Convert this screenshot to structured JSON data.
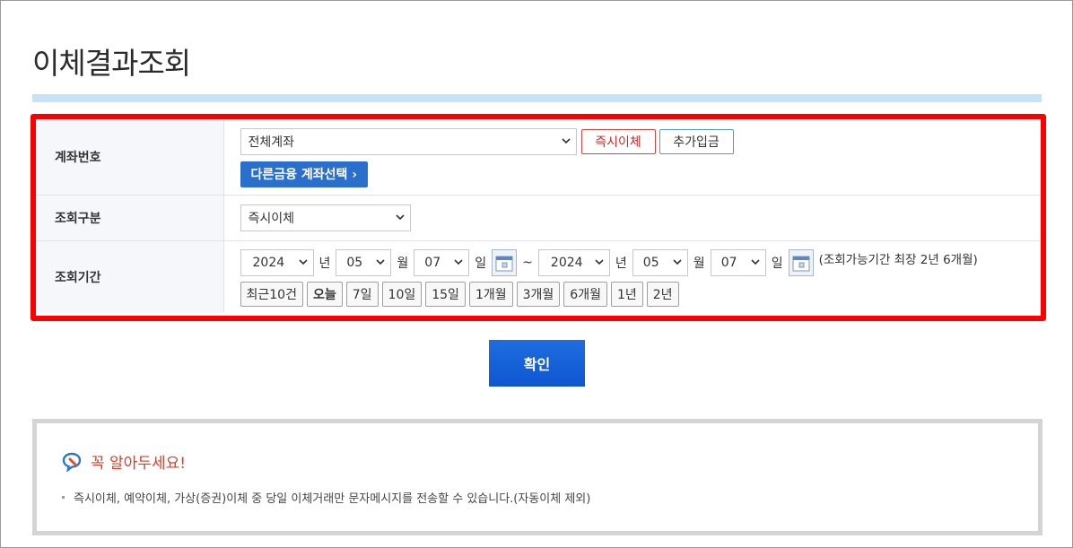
{
  "page": {
    "title": "이체결과조회"
  },
  "form": {
    "account": {
      "label": "계좌번호",
      "selected": "전체계좌",
      "btn_instant": "즉시이체",
      "btn_deposit": "추가입금",
      "btn_other": "다른금융 계좌선택 ›"
    },
    "category": {
      "label": "조회구분",
      "selected": "즉시이체"
    },
    "period": {
      "label": "조회기간",
      "from": {
        "year": "2024",
        "month": "05",
        "day": "07"
      },
      "to": {
        "year": "2024",
        "month": "05",
        "day": "07"
      },
      "unit_year": "년",
      "unit_month": "월",
      "unit_day": "일",
      "tilde": "~",
      "note": "(조회가능기간 최장 2년 6개월)",
      "quick": [
        "최근10건",
        "오늘",
        "7일",
        "10일",
        "15일",
        "1개월",
        "3개월",
        "6개월",
        "1년",
        "2년"
      ]
    }
  },
  "confirm_label": "확인",
  "notice": {
    "title": "꼭 알아두세요!",
    "item": "즉시이체, 예약이체, 가상(증권)이체 중 당일 이체거래만 문자메시지를 전송할 수 있습니다.(자동이체 제외)"
  },
  "colors": {
    "highlight": "#fb0000",
    "title_bar": "#c5e3f4",
    "primary": "#1e6de0",
    "notice_title": "#d4402a"
  }
}
